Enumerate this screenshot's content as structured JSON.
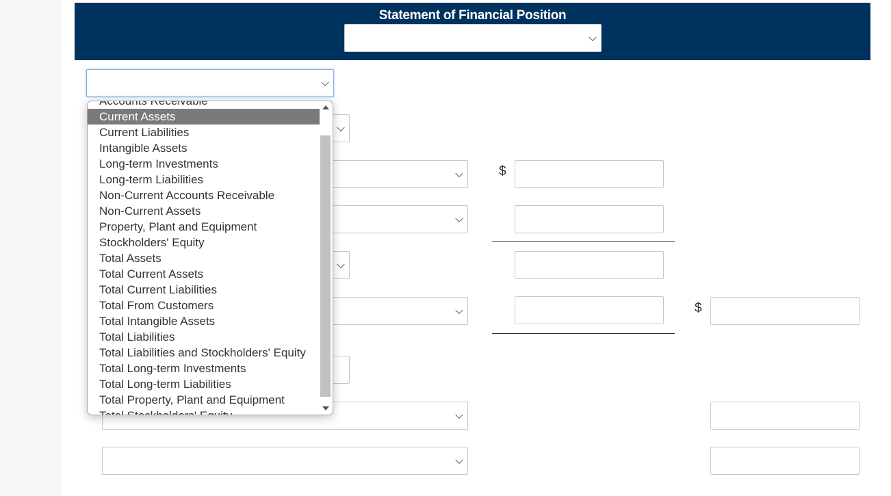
{
  "header": {
    "title": "Statement of Financial Position",
    "date_select_value": ""
  },
  "classification_select": {
    "value": ""
  },
  "dropdown": {
    "options": [
      "Accounts Receivable",
      "Current Assets",
      "Current Liabilities",
      "Intangible Assets",
      "Long-term Investments",
      "Long-term Liabilities",
      "Non-Current Accounts Receivable",
      "Non-Current Assets",
      "Property, Plant and Equipment",
      "Stockholders' Equity",
      "Total Assets",
      "Total Current Assets",
      "Total Current Liabilities",
      "Total From Customers",
      "Total Intangible Assets",
      "Total Liabilities",
      "Total Liabilities and Stockholders' Equity",
      "Total Long-term Investments",
      "Total Long-term Liabilities",
      "Total Property, Plant and Equipment",
      "Total Stockholders' Equity"
    ],
    "highlighted": "Current Assets"
  },
  "currency_symbol": "$",
  "colors": {
    "header_bg": "#00325f",
    "highlight": "#7a7a7a"
  }
}
